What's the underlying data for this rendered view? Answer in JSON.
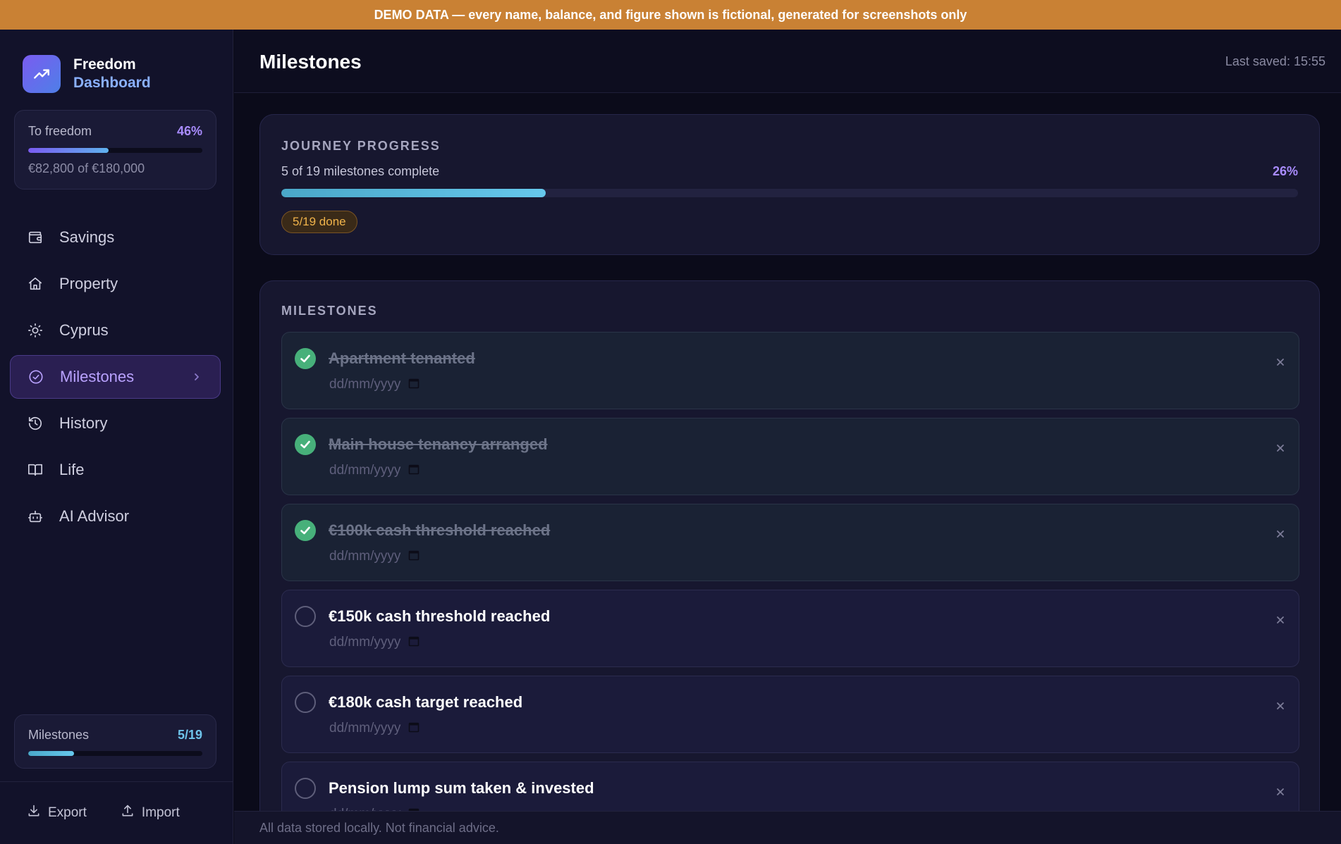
{
  "banner": {
    "text": "DEMO DATA — every name, balance, and figure shown is fictional, generated for screenshots only"
  },
  "brand": {
    "line1": "Freedom",
    "line2": "Dashboard"
  },
  "freedom_progress": {
    "label": "To freedom",
    "percent_label": "46%",
    "fraction": 0.46,
    "detail": "€82,800 of €180,000"
  },
  "nav": {
    "items": [
      {
        "label": "Savings",
        "icon": "wallet-icon",
        "active": false
      },
      {
        "label": "Property",
        "icon": "home-icon",
        "active": false
      },
      {
        "label": "Cyprus",
        "icon": "sun-icon",
        "active": false
      },
      {
        "label": "Milestones",
        "icon": "check-circle-icon",
        "active": true
      },
      {
        "label": "History",
        "icon": "history-icon",
        "active": false
      },
      {
        "label": "Life",
        "icon": "book-icon",
        "active": false
      },
      {
        "label": "AI Advisor",
        "icon": "robot-icon",
        "active": false
      }
    ]
  },
  "sidebar_milestones": {
    "label": "Milestones",
    "value": "5/19",
    "fraction": 0.263
  },
  "footer_actions": {
    "export_label": "Export",
    "import_label": "Import"
  },
  "header": {
    "title": "Milestones",
    "last_saved": "Last saved: 15:55"
  },
  "journey": {
    "title": "JOURNEY PROGRESS",
    "summary": "5 of 19 milestones complete",
    "percent_label": "26%",
    "fraction": 0.26,
    "badge": "5/19 done"
  },
  "milestones": {
    "title": "MILESTONES",
    "date_placeholder": "dd/mm/yyyy",
    "items": [
      {
        "title": "Apartment tenanted",
        "done": true
      },
      {
        "title": "Main house tenancy arranged",
        "done": true
      },
      {
        "title": "€100k cash threshold reached",
        "done": true
      },
      {
        "title": "€150k cash threshold reached",
        "done": false
      },
      {
        "title": "€180k cash target reached",
        "done": false
      },
      {
        "title": "Pension lump sum taken & invested",
        "done": false
      }
    ]
  },
  "footer_note": "All data stored locally. Not financial advice.",
  "colors": {
    "accent": "#a98cff",
    "banner": "#c98134",
    "done_green": "#47b07a",
    "badge_amber": "#f0b34a"
  }
}
